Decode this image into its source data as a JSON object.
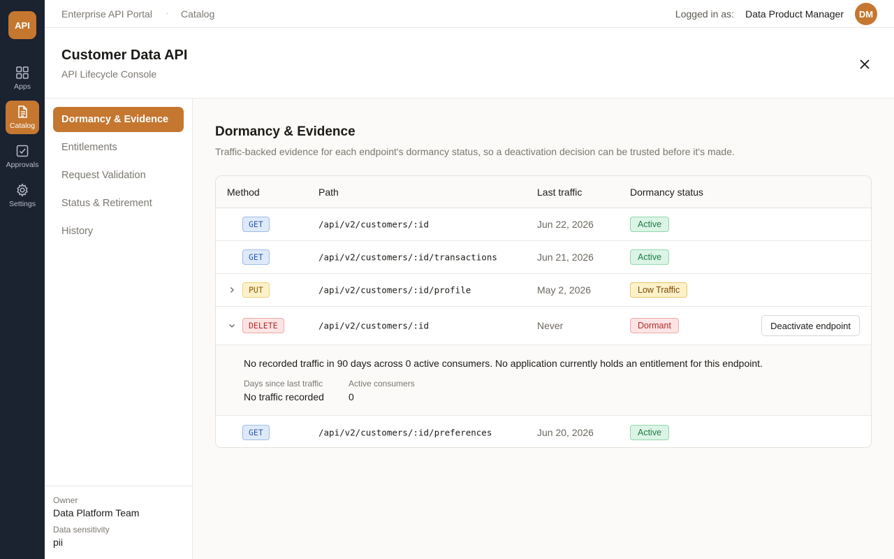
{
  "rail": {
    "logo": "API",
    "items": [
      {
        "label": "Apps",
        "icon": "grid-icon"
      },
      {
        "label": "Catalog",
        "icon": "document-icon"
      },
      {
        "label": "Approvals",
        "icon": "check-square-icon"
      },
      {
        "label": "Settings",
        "icon": "gear-icon"
      }
    ]
  },
  "topbar": {
    "portal": "Enterprise API Portal",
    "separator": "·",
    "section": "Catalog",
    "logged_label": "Logged in as:",
    "user_role": "Data Product Manager",
    "avatar_initials": "DM"
  },
  "header": {
    "title": "Customer Data API",
    "subtitle": "API Lifecycle Console"
  },
  "subnav": {
    "items": [
      {
        "label": "Dormancy & Evidence",
        "active": true
      },
      {
        "label": "Entitlements"
      },
      {
        "label": "Request Validation"
      },
      {
        "label": "Status & Retirement"
      },
      {
        "label": "History"
      }
    ],
    "owner_label": "Owner",
    "owner_value": "Data Platform Team",
    "sensitivity_label": "Data sensitivity",
    "sensitivity_value": "pii"
  },
  "main": {
    "title": "Dormancy & Evidence",
    "description": "Traffic-backed evidence for each endpoint's dormancy status, so a deactivation decision can be trusted before it's made.",
    "columns": [
      "Method",
      "Path",
      "Last traffic",
      "Dormancy status"
    ],
    "rows": [
      {
        "method": "GET",
        "path": "/api/v2/customers/:id",
        "last_traffic": "Jun 22, 2026",
        "status": "Active"
      },
      {
        "method": "GET",
        "path": "/api/v2/customers/:id/transactions",
        "last_traffic": "Jun 21, 2026",
        "status": "Active"
      },
      {
        "method": "PUT",
        "path": "/api/v2/customers/:id/profile",
        "last_traffic": "May 2, 2026",
        "status": "Low Traffic",
        "chevron": "right"
      },
      {
        "method": "DELETE",
        "path": "/api/v2/customers/:id",
        "last_traffic": "Never",
        "status": "Dormant",
        "chevron": "down",
        "action": "Deactivate endpoint"
      },
      {
        "method": "GET",
        "path": "/api/v2/customers/:id/preferences",
        "last_traffic": "Jun 20, 2026",
        "status": "Active"
      }
    ],
    "detail": {
      "text": "No recorded traffic in 90 days across 0 active consumers. No application currently holds an entitlement for this endpoint.",
      "days_label": "Days since last traffic",
      "days_value": "No traffic recorded",
      "consumers_label": "Active consumers",
      "consumers_value": "0"
    }
  },
  "colors": {
    "accent": "#c57730",
    "rail_bg": "#1b2230"
  }
}
